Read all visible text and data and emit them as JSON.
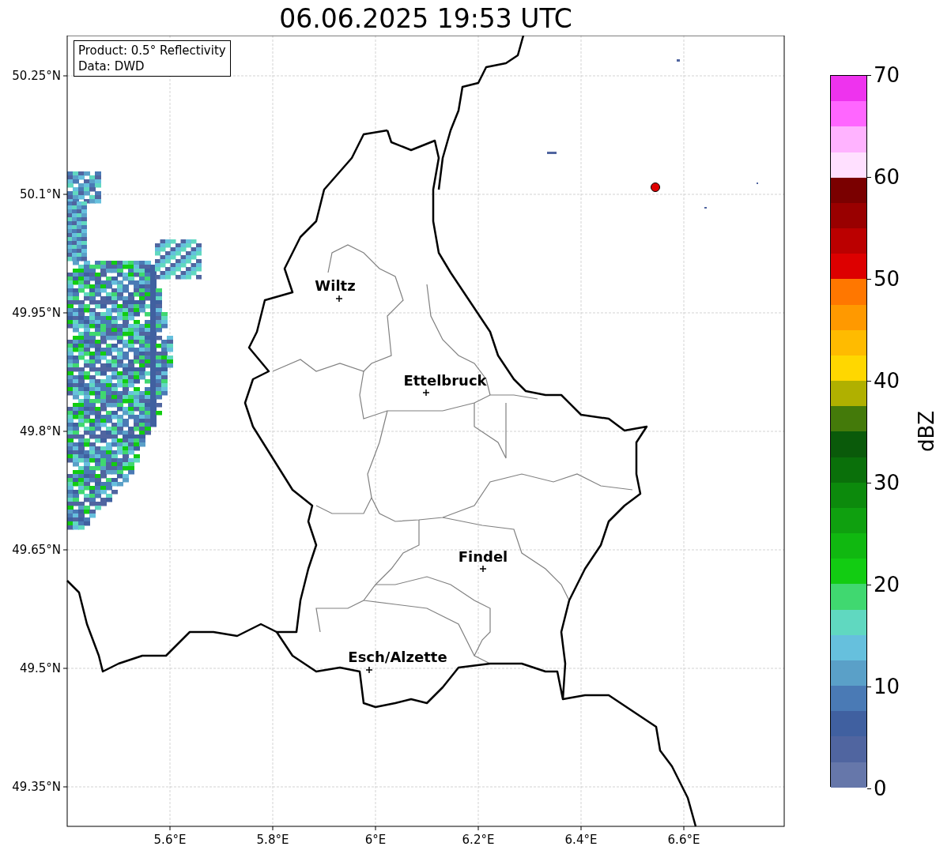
{
  "title": "06.06.2025 19:53 UTC",
  "info_box": [
    "Product: 0.5° Reflectivity",
    "Data: DWD"
  ],
  "map": {
    "lat_ticks": [
      "50.25°N",
      "50.1°N",
      "49.95°N",
      "49.8°N",
      "49.65°N",
      "49.5°N",
      "49.35°N"
    ],
    "lon_ticks": [
      "5.6°E",
      "5.8°E",
      "6°E",
      "6.2°E",
      "6.4°E",
      "6.6°E"
    ],
    "cities": [
      {
        "name": "Wiltz"
      },
      {
        "name": "Ettelbruck"
      },
      {
        "name": "Findel"
      },
      {
        "name": "Esch/Alzette"
      }
    ]
  },
  "colorbar": {
    "label": "dBZ",
    "ticks": [
      "70",
      "60",
      "50",
      "40",
      "30",
      "20",
      "10",
      "0"
    ],
    "bands": [
      {
        "color": "#ee33ee"
      },
      {
        "color": "#ff66ff"
      },
      {
        "color": "#ffb3ff"
      },
      {
        "color": "#ffe0ff"
      },
      {
        "color": "#7a0000"
      },
      {
        "color": "#990000"
      },
      {
        "color": "#bb0000"
      },
      {
        "color": "#dd0000"
      },
      {
        "color": "#ff7700"
      },
      {
        "color": "#ff9900"
      },
      {
        "color": "#ffbb00"
      },
      {
        "color": "#ffd700"
      },
      {
        "color": "#b0b000"
      },
      {
        "color": "#447a0a"
      },
      {
        "color": "#0a5a0a"
      },
      {
        "color": "#0a700a"
      },
      {
        "color": "#0c8a0c"
      },
      {
        "color": "#0fa00f"
      },
      {
        "color": "#10b810"
      },
      {
        "color": "#12cc12"
      },
      {
        "color": "#40d870"
      },
      {
        "color": "#60d8c0"
      },
      {
        "color": "#66c0dd"
      },
      {
        "color": "#5aa0c8"
      },
      {
        "color": "#4a7ab5"
      },
      {
        "color": "#4060a0"
      },
      {
        "color": "#5065a0"
      },
      {
        "color": "#6677aa"
      }
    ]
  }
}
